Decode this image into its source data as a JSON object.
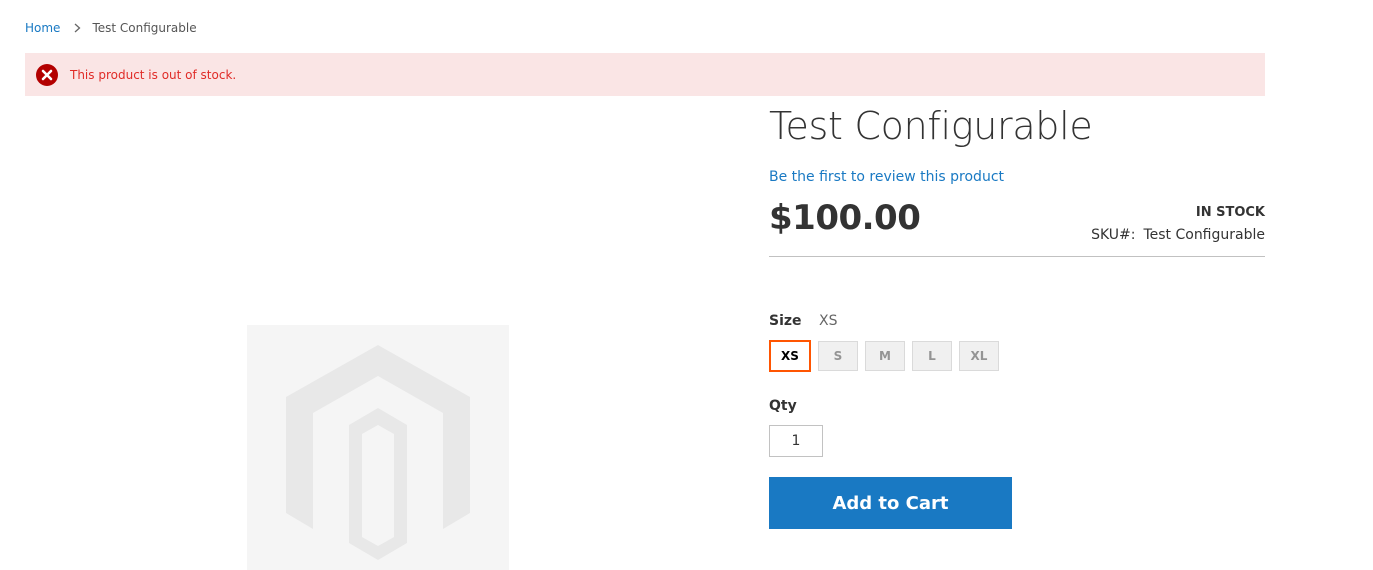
{
  "breadcrumb": {
    "home_label": "Home",
    "current_label": "Test Configurable"
  },
  "message": {
    "text": "This product is out of stock.",
    "type": "error",
    "icon": "error-x-icon",
    "color": "#e02b27",
    "background": "#fae5e5"
  },
  "gallery": {
    "placeholder_icon": "magento-logo-placeholder-icon"
  },
  "product": {
    "name": "Test Configurable",
    "review_link": "Be the first to review this product",
    "price": "$100.00",
    "stock_status": "IN STOCK",
    "sku_label": "SKU#:",
    "sku_value": "Test Configurable"
  },
  "options": {
    "size_label": "Size",
    "size_selected": "XS",
    "sizes": [
      "XS",
      "S",
      "M",
      "L",
      "XL"
    ],
    "selected_index": 0,
    "selected_border_color": "#ff5501"
  },
  "qty": {
    "label": "Qty",
    "value": "1"
  },
  "actions": {
    "add_to_cart": "Add to Cart",
    "button_color": "#1979c3"
  }
}
